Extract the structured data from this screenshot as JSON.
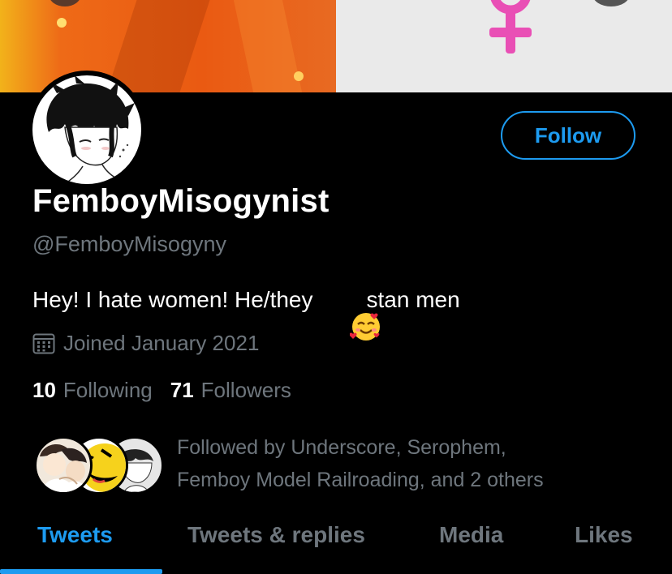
{
  "profile": {
    "display_name": "FemboyMisogynist",
    "handle": "@FemboyMisogyny",
    "bio_before": "Hey! I hate women! He/they",
    "bio_emoji": "smiling-face-with-hearts-icon",
    "bio_after": "stan men",
    "joined": "Joined January 2021"
  },
  "actions": {
    "follow_label": "Follow"
  },
  "stats": {
    "following_count": "10",
    "following_label": "Following",
    "followers_count": "71",
    "followers_label": "Followers"
  },
  "followed_by": {
    "line1": "Followed by Underscore, Serophem,",
    "line2": "Femboy Model Railroading, and 2 others"
  },
  "tabs": [
    {
      "label": "Tweets",
      "active": true
    },
    {
      "label": "Tweets & replies",
      "active": false
    },
    {
      "label": "Media",
      "active": false
    },
    {
      "label": "Likes",
      "active": false
    }
  ],
  "colors": {
    "accent": "#1d9bf0",
    "muted": "#6e767d",
    "background": "#000000",
    "venus_symbol": "#e94fb5"
  }
}
